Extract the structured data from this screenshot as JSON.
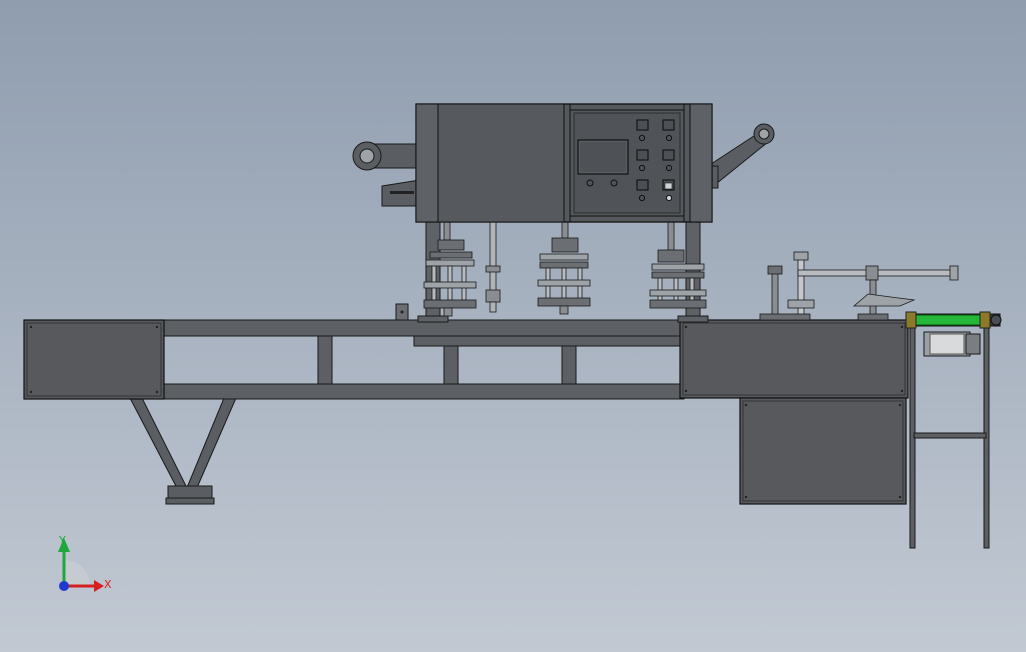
{
  "view": {
    "background_top": "#8f9daf",
    "background_bottom": "#c2c9d3"
  },
  "machine": {
    "body_color": "#5b5e62",
    "outline_color": "#1a1a1a",
    "panel_color": "#57595d"
  },
  "control_panel": {
    "screen": "display-screen",
    "buttons": [
      "square-button",
      "square-button",
      "square-button",
      "square-button",
      "square-button",
      "square-button"
    ],
    "indicator": "indicator-lamp"
  },
  "film_roller": {
    "color": "#25b838"
  },
  "triad": {
    "x_label": "X",
    "y_label": "Y",
    "x_color": "#d62020",
    "y_color": "#1ea83a",
    "z_color": "#1f3ad0"
  }
}
